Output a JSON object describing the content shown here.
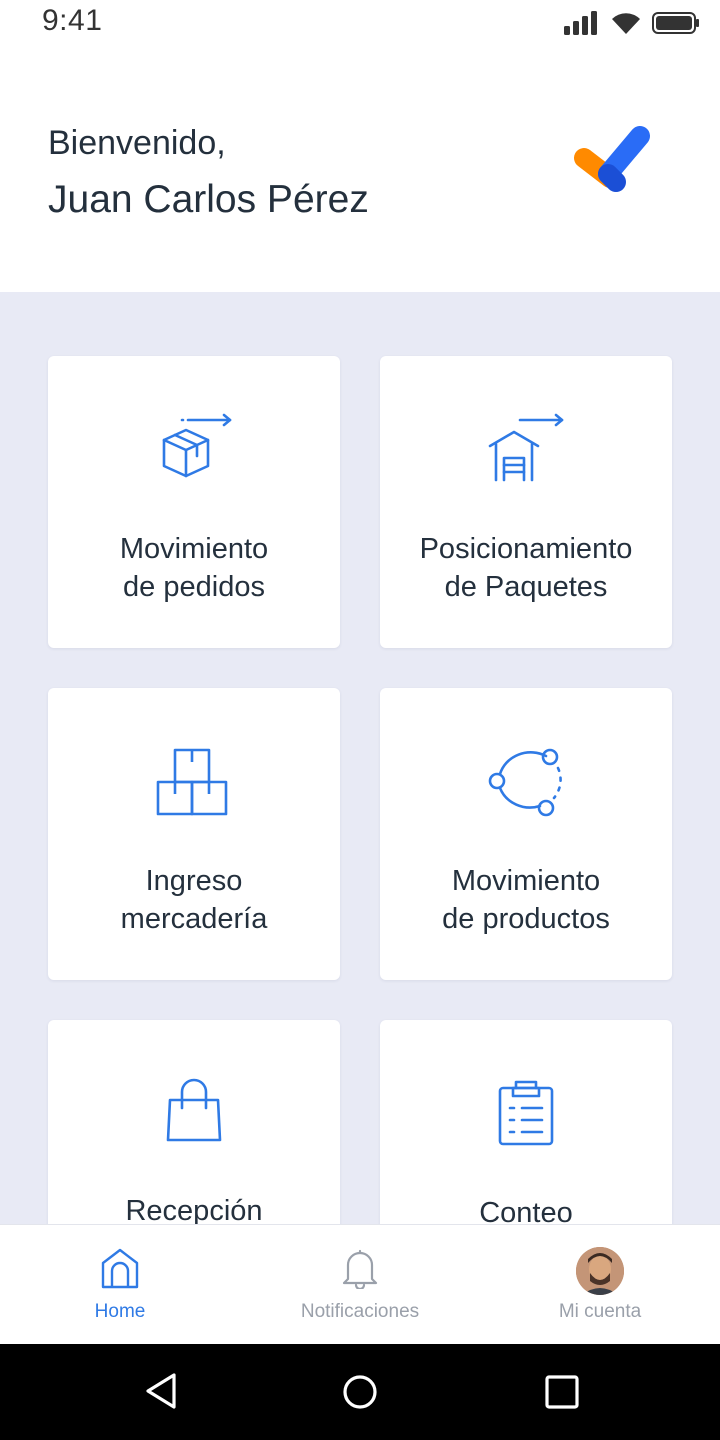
{
  "status_bar": {
    "time": "9:41"
  },
  "header": {
    "greeting": "Bienvenido,",
    "user_name": "Juan Carlos Pérez",
    "logo_icon": "brand-check-logo"
  },
  "tiles": [
    {
      "line1": "Movimiento",
      "line2": "de pedidos",
      "icon": "box-arrow-icon"
    },
    {
      "line1": "Posicionamiento",
      "line2": "de Paquetes",
      "icon": "warehouse-arrow-icon"
    },
    {
      "line1": "Ingreso",
      "line2": "mercadería",
      "icon": "stacked-boxes-icon"
    },
    {
      "line1": "Movimiento",
      "line2": "de productos",
      "icon": "rotation-nodes-icon"
    },
    {
      "line1": "Recepción",
      "line2": "",
      "icon": "shopping-bag-icon"
    },
    {
      "line1": "Conteo",
      "line2": "",
      "icon": "clipboard-list-icon"
    }
  ],
  "bottom_nav": {
    "home": "Home",
    "notifications": "Notificaciones",
    "account": "Mi cuenta"
  },
  "colors": {
    "accent": "#2f7ae5",
    "background": "#e8eaf5",
    "text": "#24303d",
    "muted": "#9aa0aa",
    "logo_orange": "#ff8a00",
    "logo_blue": "#1e5bf0"
  }
}
